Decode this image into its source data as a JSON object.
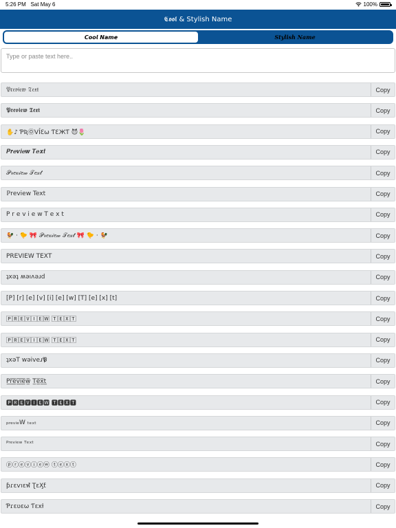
{
  "status_bar": {
    "time": "5:26 PM",
    "date": "Sat May 6",
    "battery": "100%",
    "battery_level": 1.0
  },
  "nav": {
    "title": "𝕮𝖔𝖔𝖑 & Stylish Name"
  },
  "tabs": [
    {
      "label": "𝘾𝙤𝙤𝙡 𝙉𝙖𝙢𝙚",
      "active": true
    },
    {
      "label": "𝑺𝒕𝒚𝒍𝒊𝒔𝒉 𝑵𝒂𝒎𝒆",
      "active": false
    }
  ],
  "input": {
    "placeholder": "Type or paste text here.."
  },
  "copy_label": "Copy",
  "rows": [
    "𝔓𝔯𝔢𝔳𝔦𝔢𝔴 𝔗𝔢𝔵𝔱",
    "𝕻𝖗𝖊𝖛𝖎𝖊𝖜 𝕿𝖊𝖝𝖙",
    "✋♪ ƤƦⓄVỈƐω ƬƐЖƬ 😈🌷",
    "𝑷𝒓𝒆𝒗𝒊𝒆𝒘 𝑻𝒆𝒙𝒕",
    "𝒫𝓇𝑒𝓋𝒾𝑒𝓌 𝒯𝑒𝓍𝓉",
    "ℙreview Text",
    "P r e v i e w T e x t",
    "🐓 · 🐤 🎀 𝒫𝓇𝑒𝓋𝒾𝑒𝓌 𝒯𝑒𝓍𝓉 🎀 🐤 · 🐓",
    "PREVIEW TEXT",
    "ʇxǝʇ ʍǝıʌǝɹd",
    "[P] [r] [e] [v] [i] [e] [w]  [T] [e] [x] [t]",
    "🄿🅁🄴🅅🄸🄴🅆 🅃🄴🅇🅃",
    "🄿🅁🄴🅅🄸🄴🅆 🅃🄴🅇🅃",
    "ʇxǝT wǝiv𝖾ɹ𝕻",
    "P̲̅r̲̅e̲̅v̲̅i̲̅e̲̅w̲̅ T̲̅e̲̅x̲̅t̲̅",
    "🅿🆁🅴🆅🅸🅴🆆 🆃🅴🆇🆃",
    "ₚᵣₑᵥᵢₑW ₜₑₓₜ",
    "ᴾʳᵉᵛⁱᵉʷ ᵀᵉˣᵗ",
    "ⓟⓡⓔⓥⓘⓔⓦ ⓣⓔⓧⓣ",
    "ƥɾɛѵıɛฬ ƮɛӼƭ",
    "Ƥɾɛʋɛω Ƭɛxƚ"
  ]
}
